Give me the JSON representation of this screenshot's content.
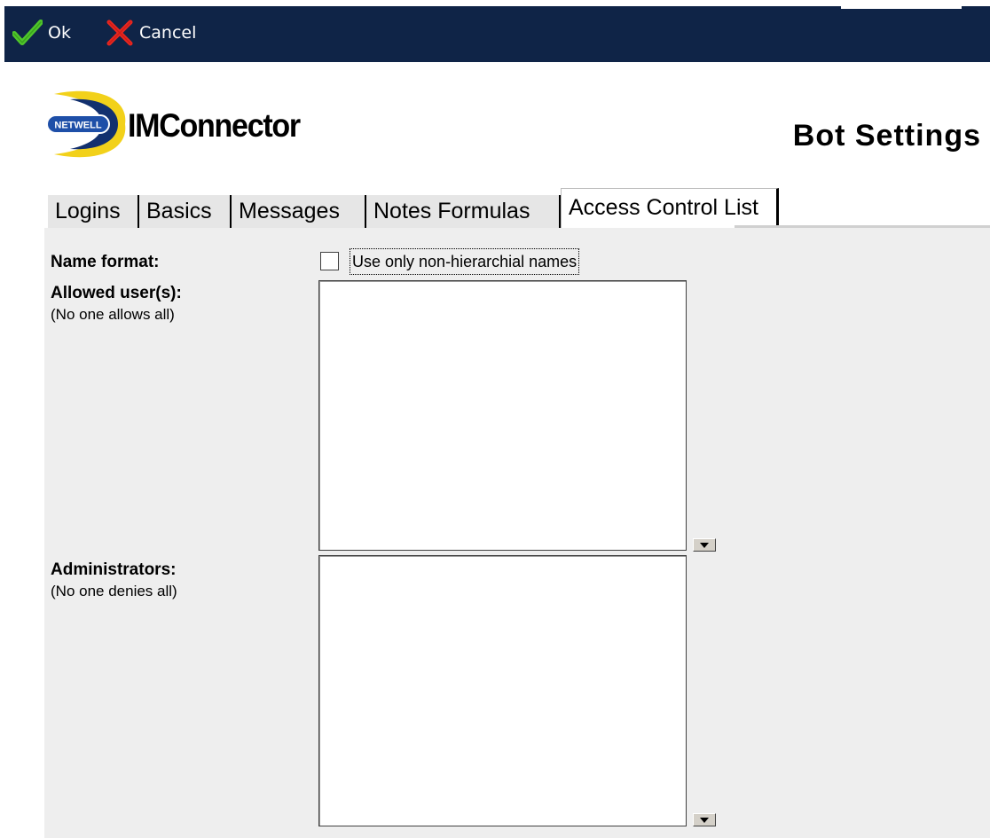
{
  "toolbar": {
    "ok_label": "Ok",
    "cancel_label": "Cancel",
    "icons": {
      "ok": "checkmark-icon",
      "cancel": "x-icon"
    },
    "colors": {
      "bar": "#0f2447",
      "check": "#4fc62b",
      "x": "#e8261f"
    }
  },
  "header": {
    "logo_badge": "NETWELL",
    "logo_text": "IMConnector",
    "title": "Bot Settings",
    "logo_colors": {
      "swoosh": "#f2d11a",
      "badge": "#1e4fa8"
    }
  },
  "tabs": [
    {
      "label": "Logins",
      "active": false
    },
    {
      "label": "Basics",
      "active": false
    },
    {
      "label": "Messages",
      "active": false
    },
    {
      "label": "Notes Formulas",
      "active": false
    },
    {
      "label": "Access Control List",
      "active": true
    }
  ],
  "form": {
    "name_format": {
      "label": "Name format:",
      "checkbox_label": "Use only non-hierarchial names",
      "checked": false
    },
    "allowed_users": {
      "label": "Allowed user(s):",
      "hint": "(No one allows all)",
      "value": ""
    },
    "administrators": {
      "label": "Administrators:",
      "hint": "(No one denies all)",
      "value": ""
    }
  }
}
